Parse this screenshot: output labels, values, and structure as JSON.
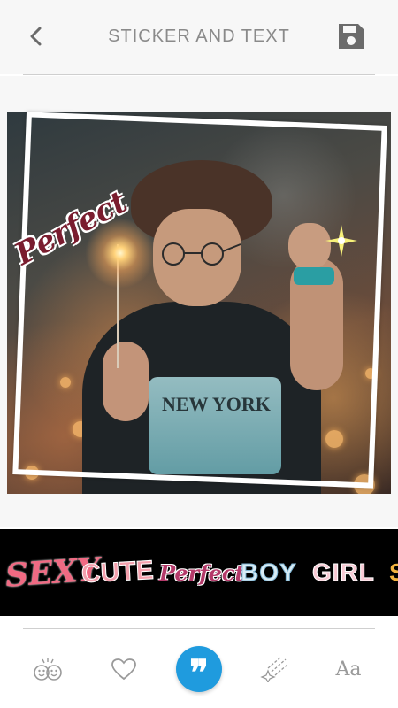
{
  "header": {
    "title": "STICKER AND TEXT",
    "back_icon": "chevron-left-icon",
    "save_icon": "floppy-disk-icon"
  },
  "canvas": {
    "photo_shirt_text": "NEW YORK",
    "stickers": [
      "Perfect",
      "sparkle-star"
    ]
  },
  "sticker_strip": {
    "items": [
      {
        "label": "SEXY"
      },
      {
        "label": "CUTE"
      },
      {
        "label": "Perfect"
      },
      {
        "label": "BOY"
      },
      {
        "label": "GIRL"
      },
      {
        "label": "S"
      }
    ]
  },
  "toolbar": {
    "items": [
      {
        "icon": "emoji-face-icon",
        "active": false
      },
      {
        "icon": "heart-icon",
        "active": false
      },
      {
        "icon": "quote-icon",
        "active": true,
        "glyph": "❞"
      },
      {
        "icon": "shooting-stars-icon",
        "active": false
      },
      {
        "icon": "text-font-icon",
        "active": false,
        "label": "Aa"
      }
    ],
    "accent_color": "#1f9bde"
  }
}
